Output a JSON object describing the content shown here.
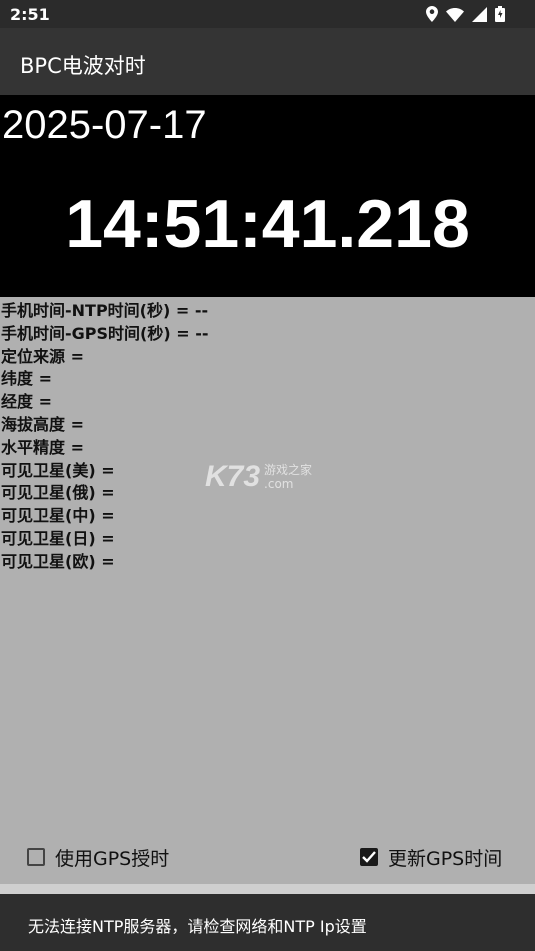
{
  "status_bar": {
    "time": "2:51",
    "icons": [
      "location-icon",
      "wifi-icon",
      "signal-icon",
      "battery-icon"
    ]
  },
  "app_bar": {
    "title": "BPC电波对时"
  },
  "clock": {
    "date": "2025-07-17",
    "time": "14:51:41.218"
  },
  "info": [
    "手机时间-NTP时间(秒) = --",
    "手机时间-GPS时间(秒) = --",
    "定位来源 =",
    "纬度 =",
    "经度 =",
    "海拔高度 =",
    "水平精度 =",
    "可见卫星(美) =",
    "可见卫星(俄) =",
    "可见卫星(中) =",
    "可见卫星(日) =",
    "可见卫星(欧) ="
  ],
  "watermark": {
    "logo": "K73",
    "line1": "游戏之家",
    "line2": ".com"
  },
  "options": {
    "use_gps": {
      "label": "使用GPS授时",
      "checked": false
    },
    "update_gps": {
      "label": "更新GPS时间",
      "checked": true
    }
  },
  "toast": {
    "message": "无法连接NTP服务器，请检查网络和NTP Ip设置"
  }
}
